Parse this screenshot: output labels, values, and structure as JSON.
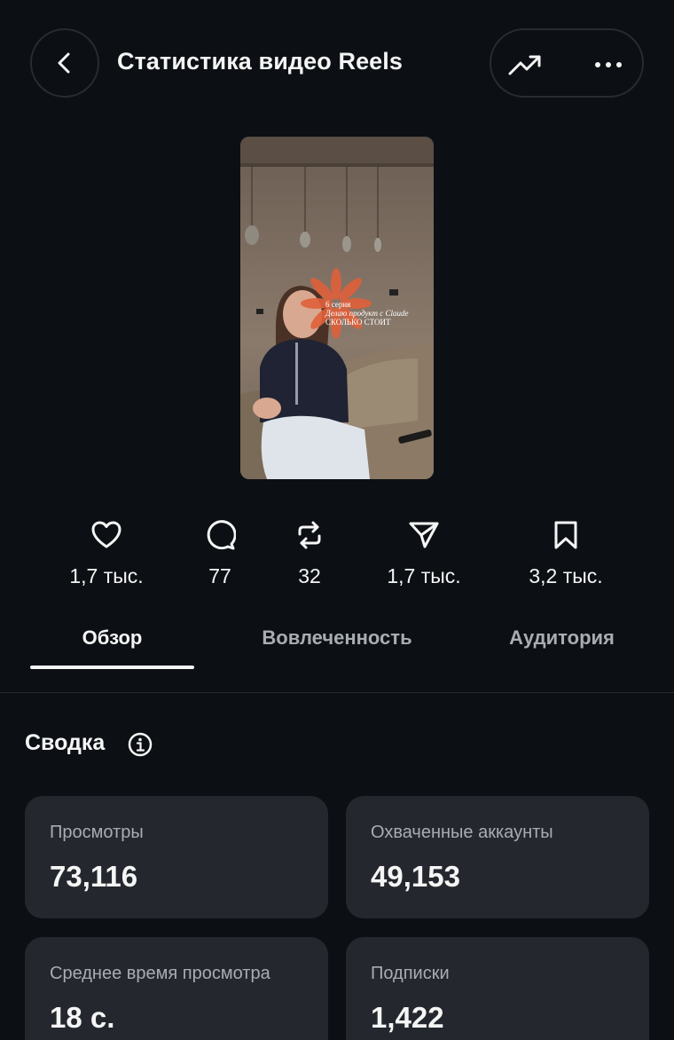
{
  "header": {
    "title": "Статистика видео Reels",
    "back_icon": "chevron-left-icon",
    "trend_icon": "trending-up-icon",
    "more_icon": "more-horizontal-icon"
  },
  "video": {
    "thumbnail_icon": "video-thumbnail",
    "overlay_line1": "6 серия",
    "overlay_line2": "Делаю продукт с Claude",
    "overlay_line3": "СКОЛЬКО СТОИТ"
  },
  "engagement": [
    {
      "icon": "heart-icon",
      "value": "1,7 тыс."
    },
    {
      "icon": "comment-icon",
      "value": "77"
    },
    {
      "icon": "repost-icon",
      "value": "32"
    },
    {
      "icon": "send-icon",
      "value": "1,7 тыс."
    },
    {
      "icon": "bookmark-icon",
      "value": "3,2 тыс."
    }
  ],
  "tabs": {
    "overview": "Обзор",
    "engagement": "Вовлеченность",
    "audience": "Аудитория"
  },
  "summary": {
    "title": "Сводка",
    "info_icon": "info-icon",
    "cards": [
      {
        "label": "Просмотры",
        "value": "73,116"
      },
      {
        "label": "Охваченные аккаунты",
        "value": "49,153"
      },
      {
        "label": "Среднее время просмотра",
        "value": "18 с."
      },
      {
        "label": "Подписки",
        "value": "1,422"
      }
    ]
  },
  "colors": {
    "background": "#0c1014",
    "card": "#24282e",
    "text_primary": "#f5f5f5",
    "text_secondary": "#a8adb3",
    "border": "#262c33"
  }
}
